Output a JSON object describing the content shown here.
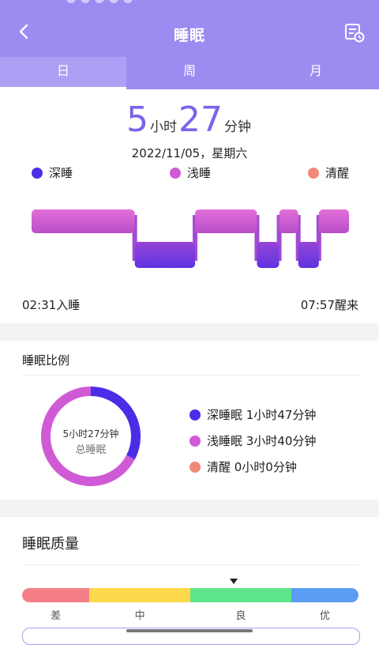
{
  "header": {
    "title": "睡眠",
    "back_icon": "chevron-left-icon",
    "calendar_icon": "calendar-history-icon",
    "background": "#9b8cf2"
  },
  "tabs": [
    {
      "label": "日",
      "active": true
    },
    {
      "label": "周",
      "active": false
    },
    {
      "label": "月",
      "active": false
    }
  ],
  "summary": {
    "hours": "5",
    "hours_unit": "小时",
    "minutes": "27",
    "minutes_unit": "分钟",
    "date": "2022/11/05，星期六"
  },
  "legend": [
    {
      "label": "深睡",
      "color": "#4a2de6"
    },
    {
      "label": "浅睡",
      "color": "#d05ad6"
    },
    {
      "label": "清醒",
      "color": "#f08a76"
    }
  ],
  "timeline": {
    "sleep_time": "02:31入睡",
    "wake_time": "07:57醒来",
    "segments": [
      {
        "stage": "light",
        "from": 0.0,
        "to": 0.325
      },
      {
        "stage": "deep",
        "from": 0.325,
        "to": 0.515
      },
      {
        "stage": "light",
        "from": 0.515,
        "to": 0.71
      },
      {
        "stage": "deep",
        "from": 0.71,
        "to": 0.78
      },
      {
        "stage": "light",
        "from": 0.78,
        "to": 0.84
      },
      {
        "stage": "deep",
        "from": 0.84,
        "to": 0.905
      },
      {
        "stage": "light",
        "from": 0.905,
        "to": 1.0
      }
    ]
  },
  "ratio": {
    "title": "睡眠比例",
    "center_value": "5小时27分钟",
    "center_label": "总睡眠",
    "items": [
      {
        "label": "深睡眠 1小时47分钟",
        "color": "#4a2de6",
        "minutes": 107
      },
      {
        "label": "浅睡眠 3小时40分钟",
        "color": "#d05ad6",
        "minutes": 220
      },
      {
        "label": "清醒 0小时0分钟",
        "color": "#f08a76",
        "minutes": 0
      }
    ]
  },
  "quality": {
    "title": "睡眠质量",
    "levels": [
      {
        "label": "差",
        "color": "#f57f86",
        "share": 0.2
      },
      {
        "label": "中",
        "color": "#fcd84a",
        "share": 0.3
      },
      {
        "label": "良",
        "color": "#5ee58a",
        "share": 0.3
      },
      {
        "label": "优",
        "color": "#5b9cf5",
        "share": 0.2
      }
    ],
    "pointer_position": 0.63
  }
}
